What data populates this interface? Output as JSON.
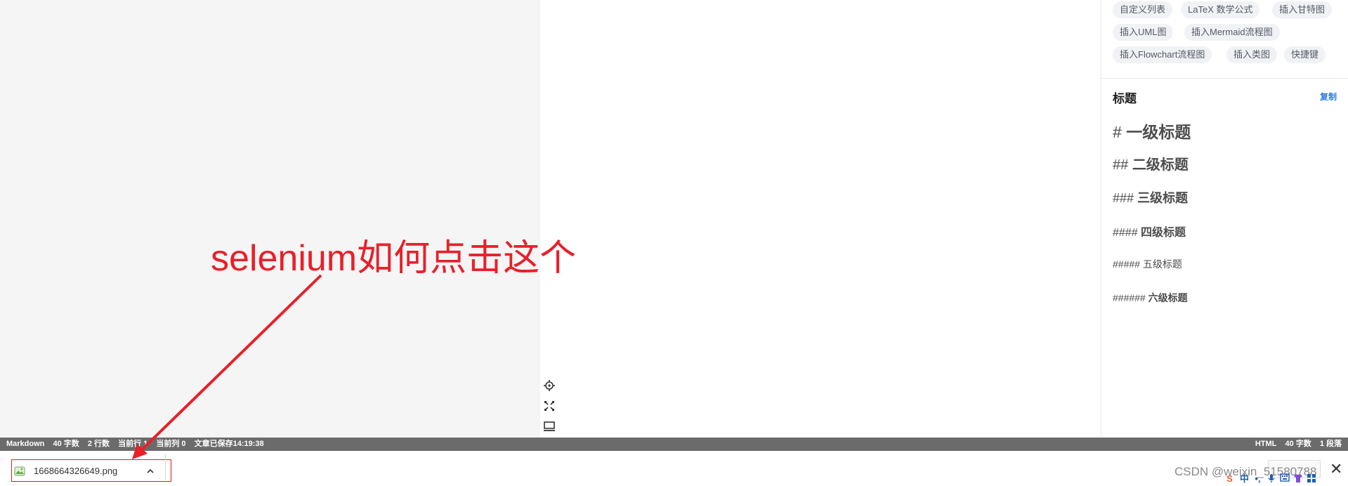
{
  "right_panel": {
    "tags": [
      "自定义列表",
      "LaTeX 数学公式",
      "插入甘特图",
      "插入UML图",
      "插入Mermaid流程图",
      "插入Flowchart流程图",
      "插入类图",
      "快捷键"
    ],
    "heading_section_title": "标题",
    "copy_label": "复制",
    "headings": [
      {
        "hash": "#",
        "text": "一级标题"
      },
      {
        "hash": "##",
        "text": "二级标题"
      },
      {
        "hash": "###",
        "text": "三级标题"
      },
      {
        "hash": "####",
        "text": "四级标题"
      },
      {
        "hash": "#####",
        "text": "五级标题"
      },
      {
        "hash": "######",
        "text": "六级标题"
      }
    ]
  },
  "toolbar_icons": [
    "crosshair-icon",
    "sync-scroll-icon",
    "preview-layout-icon"
  ],
  "statusbar": {
    "left": [
      "Markdown",
      "40 字数",
      "2 行数",
      "当前行 1",
      "当前列 0",
      "文章已保存14:19:38"
    ],
    "right": [
      "HTML",
      "40 字数",
      "1 段落"
    ]
  },
  "download": {
    "filename": "1668664326649.png",
    "icon": "image-file-icon",
    "chevron": "chevron-up-icon"
  },
  "annotation": {
    "text": "selenium如何点击这个",
    "color": "#e8202a"
  },
  "watermark": "CSDN @weixin_51580788",
  "tray": {
    "ime": "中",
    "close": "✕"
  },
  "colors": {
    "annotation_red": "#e8202a",
    "statusbar_bg": "#6b6b6b",
    "tag_bg": "#f0f2f5",
    "link_blue": "#2c7be5"
  }
}
